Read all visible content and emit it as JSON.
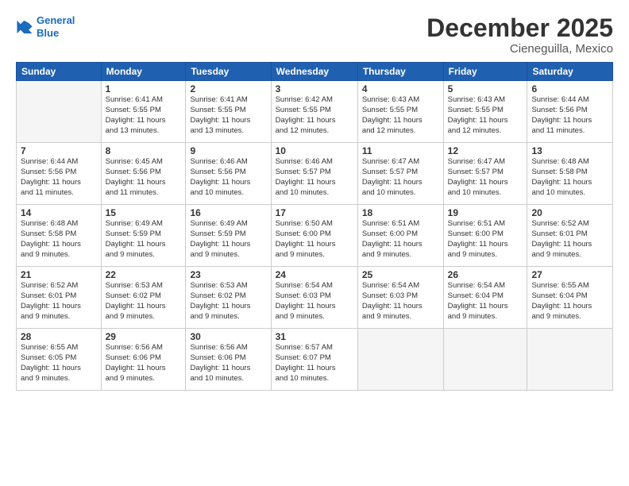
{
  "logo": {
    "line1": "General",
    "line2": "Blue"
  },
  "title": "December 2025",
  "subtitle": "Cieneguilla, Mexico",
  "days_header": [
    "Sunday",
    "Monday",
    "Tuesday",
    "Wednesday",
    "Thursday",
    "Friday",
    "Saturday"
  ],
  "weeks": [
    [
      {
        "num": "",
        "info": ""
      },
      {
        "num": "1",
        "info": "Sunrise: 6:41 AM\nSunset: 5:55 PM\nDaylight: 11 hours\nand 13 minutes."
      },
      {
        "num": "2",
        "info": "Sunrise: 6:41 AM\nSunset: 5:55 PM\nDaylight: 11 hours\nand 13 minutes."
      },
      {
        "num": "3",
        "info": "Sunrise: 6:42 AM\nSunset: 5:55 PM\nDaylight: 11 hours\nand 12 minutes."
      },
      {
        "num": "4",
        "info": "Sunrise: 6:43 AM\nSunset: 5:55 PM\nDaylight: 11 hours\nand 12 minutes."
      },
      {
        "num": "5",
        "info": "Sunrise: 6:43 AM\nSunset: 5:55 PM\nDaylight: 11 hours\nand 12 minutes."
      },
      {
        "num": "6",
        "info": "Sunrise: 6:44 AM\nSunset: 5:56 PM\nDaylight: 11 hours\nand 11 minutes."
      }
    ],
    [
      {
        "num": "7",
        "info": "Sunrise: 6:44 AM\nSunset: 5:56 PM\nDaylight: 11 hours\nand 11 minutes."
      },
      {
        "num": "8",
        "info": "Sunrise: 6:45 AM\nSunset: 5:56 PM\nDaylight: 11 hours\nand 11 minutes."
      },
      {
        "num": "9",
        "info": "Sunrise: 6:46 AM\nSunset: 5:56 PM\nDaylight: 11 hours\nand 10 minutes."
      },
      {
        "num": "10",
        "info": "Sunrise: 6:46 AM\nSunset: 5:57 PM\nDaylight: 11 hours\nand 10 minutes."
      },
      {
        "num": "11",
        "info": "Sunrise: 6:47 AM\nSunset: 5:57 PM\nDaylight: 11 hours\nand 10 minutes."
      },
      {
        "num": "12",
        "info": "Sunrise: 6:47 AM\nSunset: 5:57 PM\nDaylight: 11 hours\nand 10 minutes."
      },
      {
        "num": "13",
        "info": "Sunrise: 6:48 AM\nSunset: 5:58 PM\nDaylight: 11 hours\nand 10 minutes."
      }
    ],
    [
      {
        "num": "14",
        "info": "Sunrise: 6:48 AM\nSunset: 5:58 PM\nDaylight: 11 hours\nand 9 minutes."
      },
      {
        "num": "15",
        "info": "Sunrise: 6:49 AM\nSunset: 5:59 PM\nDaylight: 11 hours\nand 9 minutes."
      },
      {
        "num": "16",
        "info": "Sunrise: 6:49 AM\nSunset: 5:59 PM\nDaylight: 11 hours\nand 9 minutes."
      },
      {
        "num": "17",
        "info": "Sunrise: 6:50 AM\nSunset: 6:00 PM\nDaylight: 11 hours\nand 9 minutes."
      },
      {
        "num": "18",
        "info": "Sunrise: 6:51 AM\nSunset: 6:00 PM\nDaylight: 11 hours\nand 9 minutes."
      },
      {
        "num": "19",
        "info": "Sunrise: 6:51 AM\nSunset: 6:00 PM\nDaylight: 11 hours\nand 9 minutes."
      },
      {
        "num": "20",
        "info": "Sunrise: 6:52 AM\nSunset: 6:01 PM\nDaylight: 11 hours\nand 9 minutes."
      }
    ],
    [
      {
        "num": "21",
        "info": "Sunrise: 6:52 AM\nSunset: 6:01 PM\nDaylight: 11 hours\nand 9 minutes."
      },
      {
        "num": "22",
        "info": "Sunrise: 6:53 AM\nSunset: 6:02 PM\nDaylight: 11 hours\nand 9 minutes."
      },
      {
        "num": "23",
        "info": "Sunrise: 6:53 AM\nSunset: 6:02 PM\nDaylight: 11 hours\nand 9 minutes."
      },
      {
        "num": "24",
        "info": "Sunrise: 6:54 AM\nSunset: 6:03 PM\nDaylight: 11 hours\nand 9 minutes."
      },
      {
        "num": "25",
        "info": "Sunrise: 6:54 AM\nSunset: 6:03 PM\nDaylight: 11 hours\nand 9 minutes."
      },
      {
        "num": "26",
        "info": "Sunrise: 6:54 AM\nSunset: 6:04 PM\nDaylight: 11 hours\nand 9 minutes."
      },
      {
        "num": "27",
        "info": "Sunrise: 6:55 AM\nSunset: 6:04 PM\nDaylight: 11 hours\nand 9 minutes."
      }
    ],
    [
      {
        "num": "28",
        "info": "Sunrise: 6:55 AM\nSunset: 6:05 PM\nDaylight: 11 hours\nand 9 minutes."
      },
      {
        "num": "29",
        "info": "Sunrise: 6:56 AM\nSunset: 6:06 PM\nDaylight: 11 hours\nand 9 minutes."
      },
      {
        "num": "30",
        "info": "Sunrise: 6:56 AM\nSunset: 6:06 PM\nDaylight: 11 hours\nand 10 minutes."
      },
      {
        "num": "31",
        "info": "Sunrise: 6:57 AM\nSunset: 6:07 PM\nDaylight: 11 hours\nand 10 minutes."
      },
      {
        "num": "",
        "info": ""
      },
      {
        "num": "",
        "info": ""
      },
      {
        "num": "",
        "info": ""
      }
    ]
  ]
}
